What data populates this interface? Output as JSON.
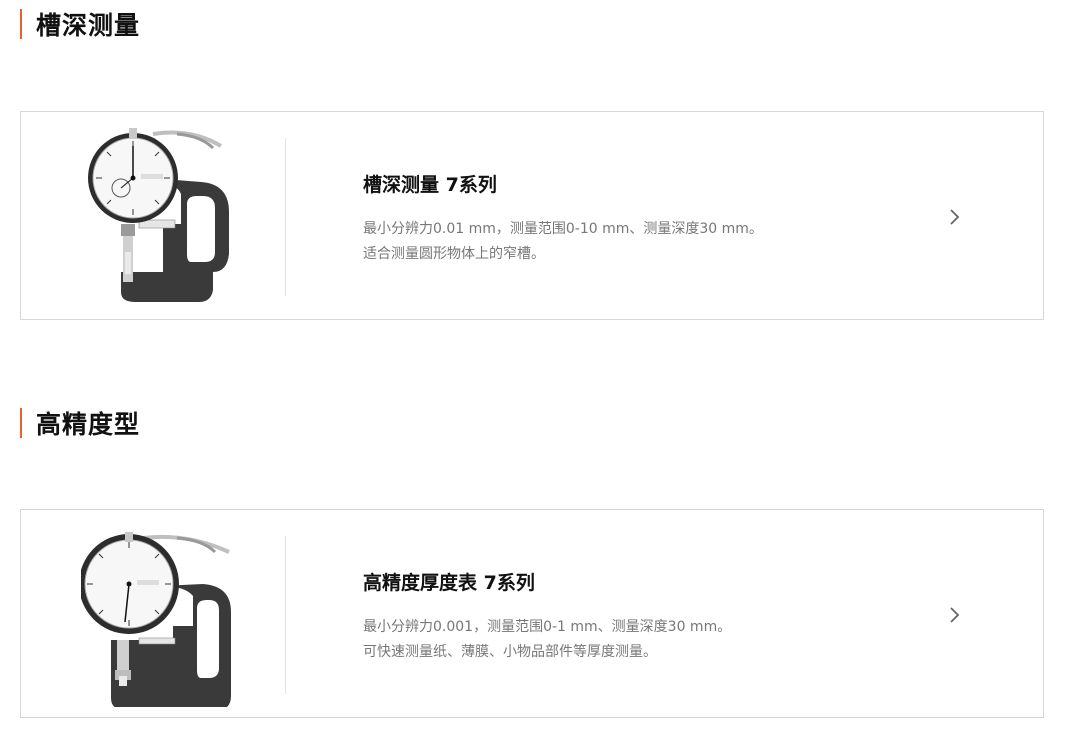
{
  "sections": [
    {
      "heading": "槽深测量",
      "card": {
        "title": "槽深测量 7系列",
        "desc_line1": "最小分辨力0.01 mm，测量范围0-10 mm、测量深度30 mm。",
        "desc_line2": "适合测量圆形物体上的窄槽。",
        "image": "groove-depth-gauge-image"
      }
    },
    {
      "heading": "高精度型",
      "card": {
        "title": "高精度厚度表 7系列",
        "desc_line1": "最小分辨力0.001，测量范围0-1 mm、测量深度30 mm。",
        "desc_line2": "可快速测量纸、薄膜、小物品部件等厚度测量。",
        "image": "high-precision-thickness-gauge-image"
      }
    }
  ],
  "colors": {
    "accent": "#e8632b",
    "card_border": "#d6d6d6",
    "text_muted": "#777777",
    "gauge_body": "#3a3a3a"
  },
  "icons": {
    "card_arrow": "chevron-right-icon"
  }
}
